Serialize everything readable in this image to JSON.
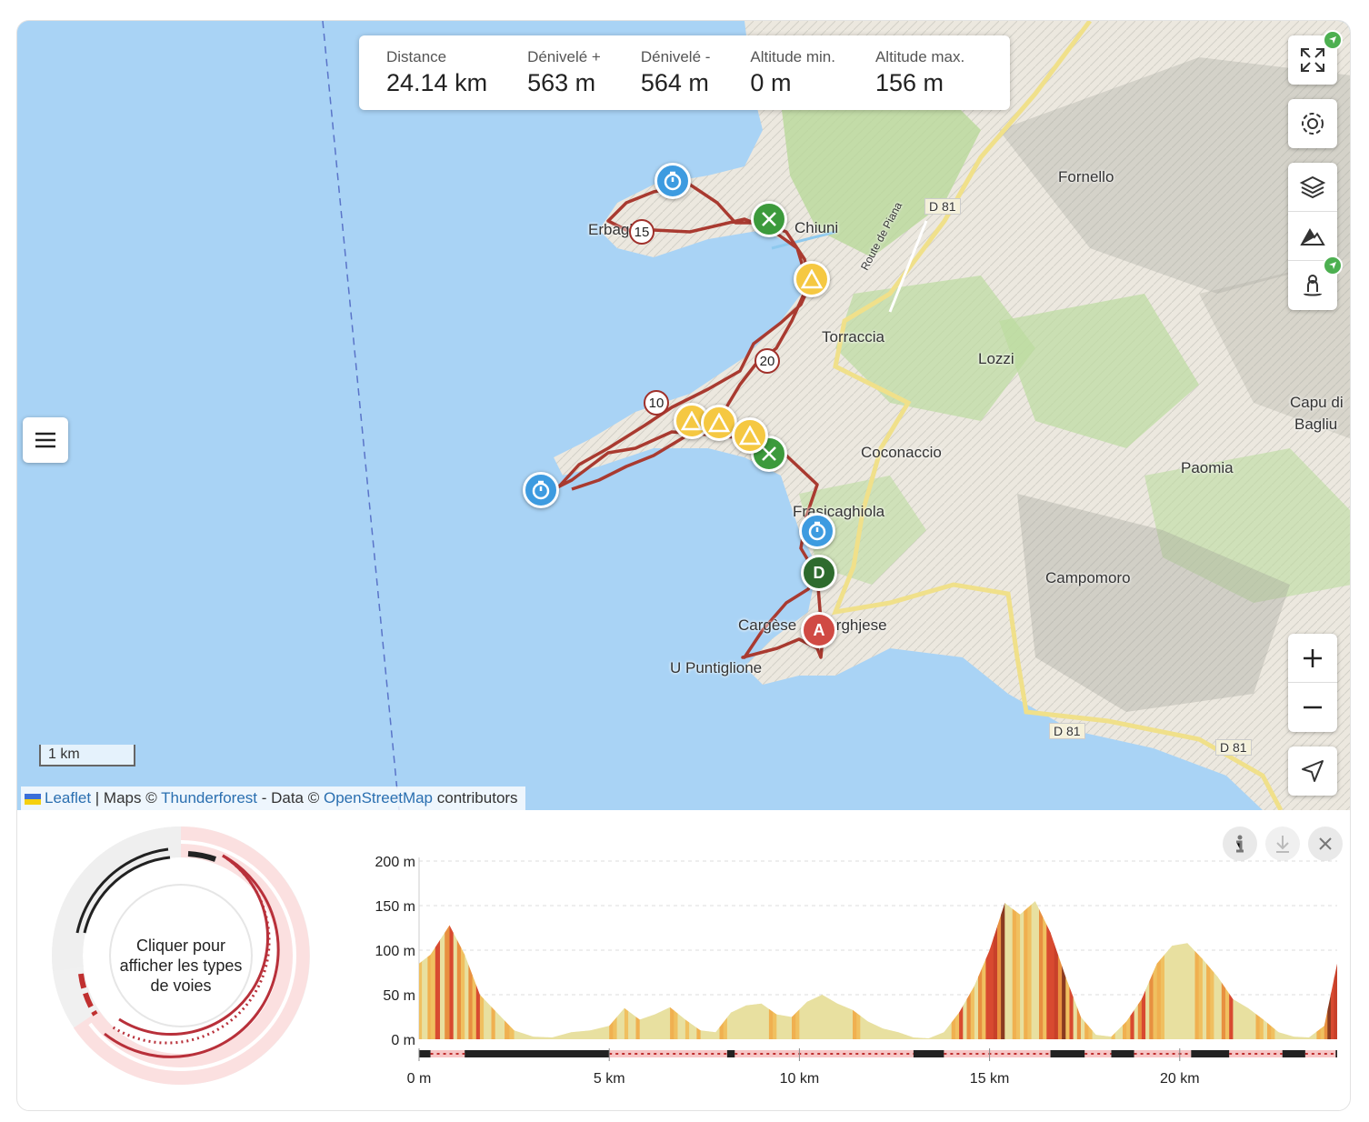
{
  "stats": [
    {
      "label": "Distance",
      "value": "24.14 km"
    },
    {
      "label": "Dénivelé +",
      "value": "563 m"
    },
    {
      "label": "Dénivelé -",
      "value": "564 m"
    },
    {
      "label": "Altitude min.",
      "value": "0 m"
    },
    {
      "label": "Altitude max.",
      "value": "156 m"
    }
  ],
  "map_labels": {
    "fornello": "Fornello",
    "chiuni": "Chiuni",
    "d81_a": "D 81",
    "d81_b": "D 81",
    "d81_c": "D 81",
    "route": "Route de Piana",
    "torraccia": "Torraccia",
    "lozzi": "Lozzi",
    "capu": "Capu di",
    "bagliu": "Bagliu",
    "coconaccio": "Coconaccio",
    "paomia": "Paomia",
    "frasicaghiola": "Frasicaghiola",
    "campomoro": "Campomoro",
    "cargese": "Cargèse",
    "barghjese": "Barghjese",
    "puntiglione": "U Puntiglione",
    "erbaghju": "Erbaghju"
  },
  "km_markers": [
    "15",
    "20",
    "10"
  ],
  "start_marker": "D",
  "end_marker": "A",
  "scale_label": "1 km",
  "attribution": {
    "leaflet": "Leaflet",
    "sep": " | Maps © ",
    "thunderforest": "Thunderforest",
    "data": " - Data © ",
    "osm": "OpenStreetMap",
    "contrib": " contributors"
  },
  "donut_text": "Cliquer pour afficher les types de voies",
  "colors": {
    "route": "#a93a30",
    "water": "#a9d3f5",
    "start": "#2e6b2e",
    "end": "#d04a44",
    "timer": "#3d9be0",
    "food": "#3c9a3c",
    "warning": "#f5c842"
  },
  "chart_data": {
    "type": "area",
    "title": "",
    "xlabel": "",
    "ylabel": "",
    "ylim": [
      0,
      200
    ],
    "xlim": [
      0,
      24.14
    ],
    "y_ticks": [
      "200 m",
      "150 m",
      "100 m",
      "50 m",
      "0 m"
    ],
    "x_ticks": [
      "0 m",
      "5 km",
      "10 km",
      "15 km",
      "20 km"
    ],
    "x": [
      0,
      0.3,
      0.8,
      1.2,
      1.6,
      2.0,
      2.5,
      3.0,
      3.5,
      4.0,
      4.5,
      5.0,
      5.4,
      5.8,
      6.2,
      6.6,
      7.0,
      7.4,
      7.8,
      8.2,
      8.6,
      9.0,
      9.4,
      9.8,
      10.2,
      10.6,
      11.0,
      11.4,
      11.8,
      12.2,
      12.6,
      13.0,
      13.4,
      13.8,
      14.2,
      14.6,
      15.0,
      15.4,
      15.8,
      16.2,
      16.6,
      17.0,
      17.4,
      17.8,
      18.2,
      18.6,
      19.0,
      19.4,
      19.8,
      20.2,
      20.6,
      21.0,
      21.4,
      21.8,
      22.2,
      22.6,
      23.0,
      23.4,
      23.8,
      24.14
    ],
    "y": [
      85,
      95,
      128,
      95,
      50,
      32,
      10,
      3,
      2,
      8,
      10,
      15,
      35,
      22,
      28,
      36,
      22,
      10,
      8,
      30,
      38,
      40,
      28,
      25,
      42,
      50,
      40,
      33,
      20,
      12,
      8,
      2,
      1,
      8,
      30,
      60,
      100,
      153,
      140,
      155,
      120,
      70,
      25,
      5,
      3,
      20,
      45,
      85,
      105,
      108,
      90,
      70,
      45,
      35,
      22,
      8,
      3,
      2,
      15,
      85
    ]
  },
  "tools": {
    "info": "info-icon",
    "download": "download-icon",
    "close": "close-icon"
  }
}
